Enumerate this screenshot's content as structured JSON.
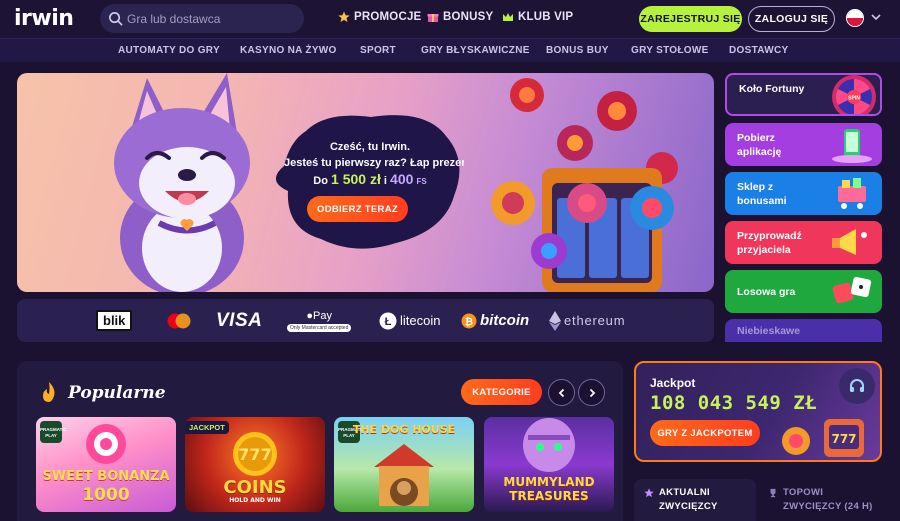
{
  "header": {
    "logo": "irwin",
    "search_placeholder": "Gra lub dostawca",
    "nav": [
      {
        "label": "PROMOCJE",
        "icon": "star-icon"
      },
      {
        "label": "BONUSY",
        "icon": "gift-icon"
      },
      {
        "label": "KLUB VIP",
        "icon": "crown-icon"
      }
    ],
    "register_label": "ZAREJESTRUJ SIĘ",
    "login_label": "ZALOGUJ SIĘ",
    "language_flag": "flag-poland-icon"
  },
  "categories": [
    "AUTOMATY DO GRY",
    "KASYNO NA ŻYWO",
    "SPORT",
    "GRY BŁYSKAWICZNE",
    "BONUS BUY",
    "GRY STOŁOWE",
    "DOSTAWCY"
  ],
  "hero": {
    "line1": "Cześć, tu Irwin.",
    "line2": "Jesteś tu pierwszy raz? Łap prezent!",
    "prefix": "Do",
    "amount_zl": "1 500 zł",
    "sep": "i",
    "amount_fs": "400",
    "fs_label": "FS",
    "cta": "ODBIERZ TERAZ"
  },
  "payments": {
    "blik": "blik",
    "mastercard": "mastercard-icon",
    "visa": "VISA",
    "applepay": "Pay",
    "applepay_note": "Only Mastercard accepted",
    "litecoin": "litecoin",
    "bitcoin": "bitcoin",
    "ethereum": "ethereum"
  },
  "promos": [
    {
      "label": "Koło Fortuny",
      "color": "#2a1f4e"
    },
    {
      "label": "Pobierz aplikację",
      "color": "#a43ee0"
    },
    {
      "label": "Sklep z bonusami",
      "color": "#1b7fe8"
    },
    {
      "label": "Przyprowadź przyjaciela",
      "color": "#f0365a"
    },
    {
      "label": "Losowa gra",
      "color": "#1fa83e"
    },
    {
      "label": "Niebieskawe",
      "color": "#4b2fa8"
    }
  ],
  "wheel_spin": "SPIN",
  "popular": {
    "title": "Popularne",
    "categories_button": "KATEGORIE",
    "games": [
      {
        "title": "SWEET BONANZA",
        "subtitle": "1000",
        "badge": "PRAGMATIC PLAY"
      },
      {
        "title": "COINS",
        "subtitle": "HOLD AND WIN",
        "badge": "JACKPOT"
      },
      {
        "title": "THE DOG HOUSE",
        "subtitle": "",
        "badge": "PRAGMATIC PLAY"
      },
      {
        "title": "MUMMYLAND",
        "subtitle": "TREASURES",
        "badge": ""
      }
    ]
  },
  "jackpot": {
    "label": "Jackpot",
    "amount": "108 043 549 ZŁ",
    "cta": "GRY Z JACKPOTEM"
  },
  "winners": {
    "tab1": "AKTUALNI ZWYCIĘZCY",
    "tab2": "TOPOWI ZWYCIĘZCY (24 H)"
  },
  "colors": {
    "accent_green": "#b6f23b",
    "accent_orange": "#ff5a1f",
    "background": "#1a1230"
  }
}
